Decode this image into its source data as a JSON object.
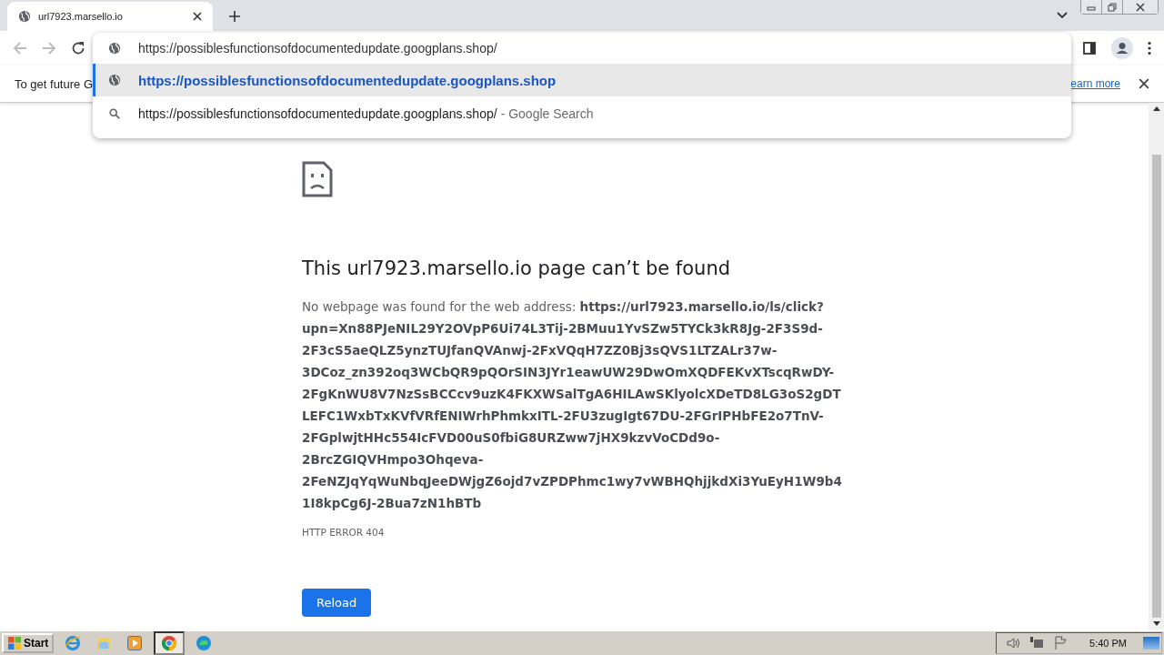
{
  "tab": {
    "title": "url7923.marsello.io"
  },
  "omnibox": {
    "text": "https://possiblesfunctionsofdocumentedupdate.googplans.shop/"
  },
  "suggestions": [
    {
      "kind": "url",
      "text": "https://possiblesfunctionsofdocumentedupdate.googplans.shop",
      "selected": true
    },
    {
      "kind": "search",
      "text": "https://possiblesfunctionsofdocumentedupdate.googplans.shop/",
      "suffix": "- Google Search",
      "selected": false
    }
  ],
  "infobar": {
    "text": "To get future G",
    "link": "earn more"
  },
  "error": {
    "title": "This url7923.marsello.io page can’t be found",
    "message": "No webpage was found for the web address: **https://url7923.marsello.io/ls/click?upn=Xn88PJeNIL29Y2OVpP6Ui74L3Tij-2BMuu1YvSZw5TYCk3kR8Jg-2F3S9d-2F3cS5aeQLZ5ynzTUJfanQVAnwj-2FxVQqH7ZZ0Bj3sQVS1LTZALr37w-3DCoz_zn392oq3WCbQR9pQOrSIN3JYr1eawUW29DwOmXQDFEKvXTscqRwDY-2FgKnWU8V7NzSsBCCcv9uzK4FKXWSalTgA6HILAwSKlyolcXDeTD8LG3oS2gDTLEFC1WxbTxKVfVRfENIWrhPhmkxITL-2FU3zugIgt67DU-2FGrIPHbFE2o7TnV-2FGplwjtHHc554IcFVD00uS0fbiG8URZww7jHX9kzvVoCDd9o-2BrcZGIQVHmpo3Ohqeva-2FeNZJqYqWuNbqJeeDWjgZ6ojd7vZPDPhmc1wy7vWBHQhjjkdXi3YuEyH1W9b41I8kpCg6J-2Bua7zN1hBTb**",
    "code": "HTTP ERROR 404",
    "button": "Reload"
  },
  "taskbar": {
    "start": "Start",
    "apps": [
      {
        "kind": "ie",
        "active": false
      },
      {
        "kind": "folder",
        "active": false
      },
      {
        "kind": "media",
        "active": false
      },
      {
        "kind": "chrome",
        "active": true
      },
      {
        "kind": "edge",
        "active": false
      }
    ],
    "clock": "5:40 PM"
  }
}
